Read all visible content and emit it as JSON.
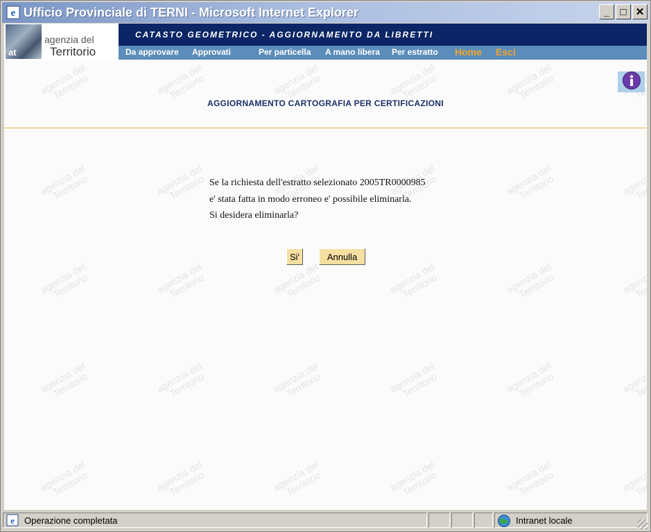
{
  "window": {
    "title": "Ufficio Provinciale di TERNI - Microsoft Internet Explorer",
    "controls": [
      "_",
      "□",
      "✕"
    ]
  },
  "logo": {
    "line1": "agenzia del",
    "line2": "Territorio",
    "badge": "at"
  },
  "header": {
    "banner": "CATASTO GEOMETRICO - AGGIORNAMENTO DA LIBRETTI"
  },
  "menu": [
    {
      "label": "Da approvare",
      "accent": false
    },
    {
      "label": "Approvati",
      "accent": false
    },
    {
      "label": "Per particella",
      "accent": false
    },
    {
      "label": "A mano libera",
      "accent": false
    },
    {
      "label": "Per estratto",
      "accent": false
    },
    {
      "label": "Home",
      "accent": true
    },
    {
      "label": "Esci",
      "accent": true
    }
  ],
  "watermark": {
    "line1": "agenzia del",
    "line2": "Territorio"
  },
  "page": {
    "title": "AGGIORNAMENTO CARTOGRAFIA PER CERTIFICAZIONI",
    "message": [
      "Se la richiesta dell'estratto selezionato 2005TR0000985",
      "e' stata fatta in modo erroneo e' possibile eliminarla.",
      "Si desidera eliminarla?"
    ],
    "buttons": {
      "confirm": "Si'",
      "cancel": "Annulla"
    }
  },
  "status": {
    "text": "Operazione completata",
    "zone": "Intranet locale"
  },
  "colors": {
    "banner": "#0b2566",
    "menu": "#5c8dba",
    "accent": "#f2a52d",
    "button": "#f6dfa1",
    "divider": "#e8ad4a"
  },
  "icons": {
    "title": "ie-icon",
    "info": "info-icon",
    "zone": "globe-icon",
    "status": "ie-page-icon"
  }
}
